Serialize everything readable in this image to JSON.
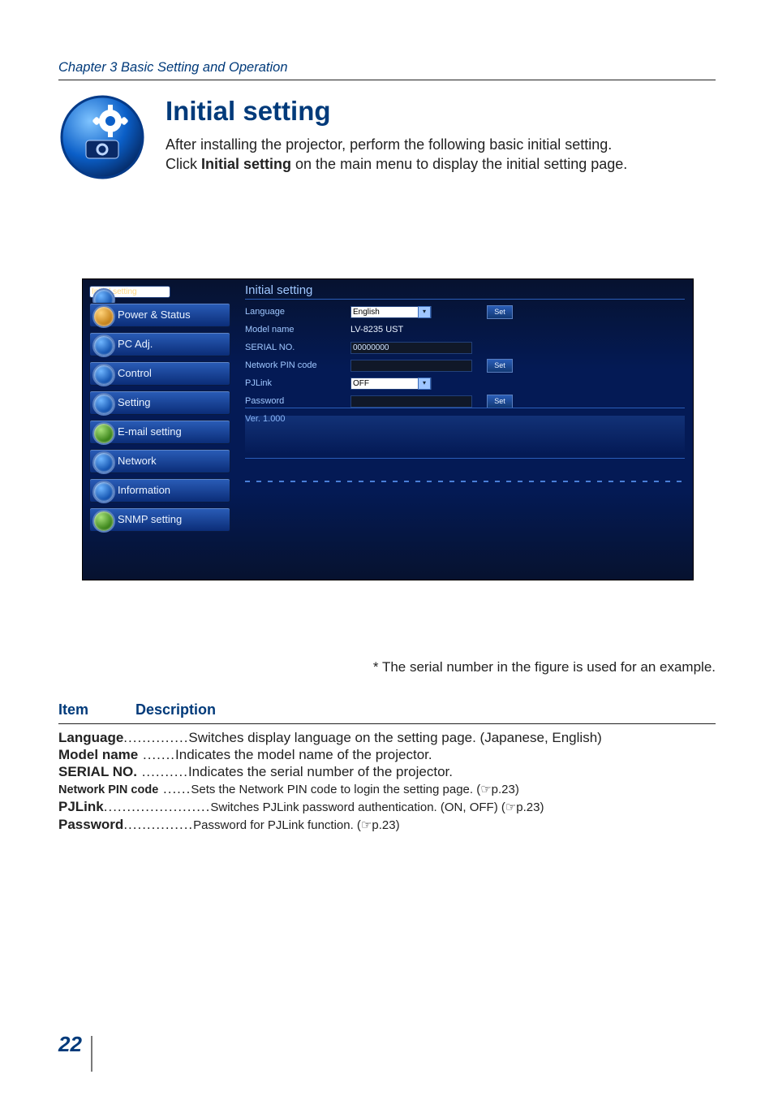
{
  "chapter": "Chapter 3 Basic Setting and Operation",
  "title": "Initial setting",
  "intro_line1": "After installing the projector, perform the following basic initial setting.",
  "intro_line2_a": "Click ",
  "intro_line2_bold": "Initial setting",
  "intro_line2_b": " on the main menu to display the initial setting page.",
  "screenshot": {
    "panel_title": "Initial setting",
    "menu": [
      "Initial setting",
      "Power & Status",
      "PC Adj.",
      "Control",
      "Setting",
      "E-mail setting",
      "Network",
      "Information",
      "SNMP setting"
    ],
    "rows": {
      "language": {
        "label": "Language",
        "value": "English",
        "button": "Set"
      },
      "model": {
        "label": "Model name",
        "value": "LV-8235 UST"
      },
      "serial": {
        "label": "SERIAL NO.",
        "value": "00000000"
      },
      "pin": {
        "label": "Network PIN code",
        "value": "",
        "button": "Set"
      },
      "pjlink": {
        "label": "PJLink",
        "value": "OFF"
      },
      "password": {
        "label": "Password",
        "value": "",
        "button": "Set"
      },
      "ver": {
        "label": "Ver. 1.000"
      }
    }
  },
  "caption": "* The serial number in the figure is used for an example.",
  "table_header": {
    "item": "Item",
    "desc": "Description"
  },
  "table": [
    {
      "k": "Language",
      "dots": "..............",
      "d": "Switches display language on the setting page. (Japanese, English)"
    },
    {
      "k": "Model name",
      "dots": " .......",
      "d": "Indicates the model name of the projector."
    },
    {
      "k": "SERIAL NO.",
      "dots": " ..........",
      "d": "Indicates the serial number of the projector."
    },
    {
      "k": "Network PIN code",
      "sm": true,
      "dots": " ......",
      "d": "Sets the Network PIN code to login the setting page. (☞p.23)"
    },
    {
      "k": "PJLink",
      "dots": ".......................",
      "d": "Switches PJLink password authentication. (ON, OFF) (☞p.23)"
    },
    {
      "k": "Password",
      "dots": "...............",
      "d": "Password for PJLink function. (☞p.23)"
    }
  ],
  "page_number": "22"
}
